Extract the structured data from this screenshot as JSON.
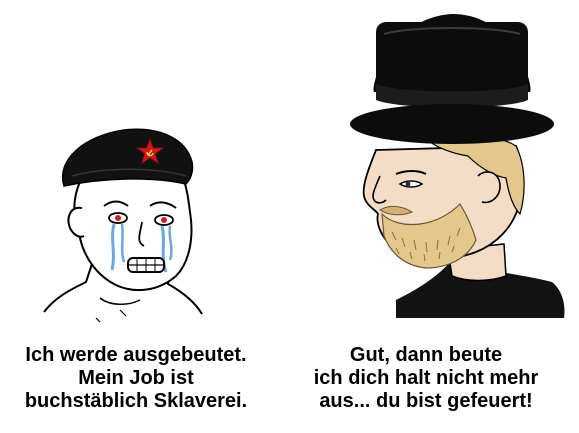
{
  "left_panel": {
    "caption_lines": [
      "Ich werde ausgebeutet.",
      "Mein Job ist",
      "buchstäblich Sklaverei."
    ],
    "hat_icon": "red-star-hammer-sickle-icon",
    "hat_color": "#111111",
    "star_color": "#d01818",
    "tear_color": "#6aa8e0"
  },
  "right_panel": {
    "caption_lines": [
      "Gut, dann beute",
      "ich dich halt nicht mehr",
      "aus... du bist gefeuert!"
    ],
    "hat_color": "#0c0c0c",
    "hair_color": "#e2c88c",
    "skin_color": "#f3ddc6",
    "shirt_color": "#121212"
  }
}
